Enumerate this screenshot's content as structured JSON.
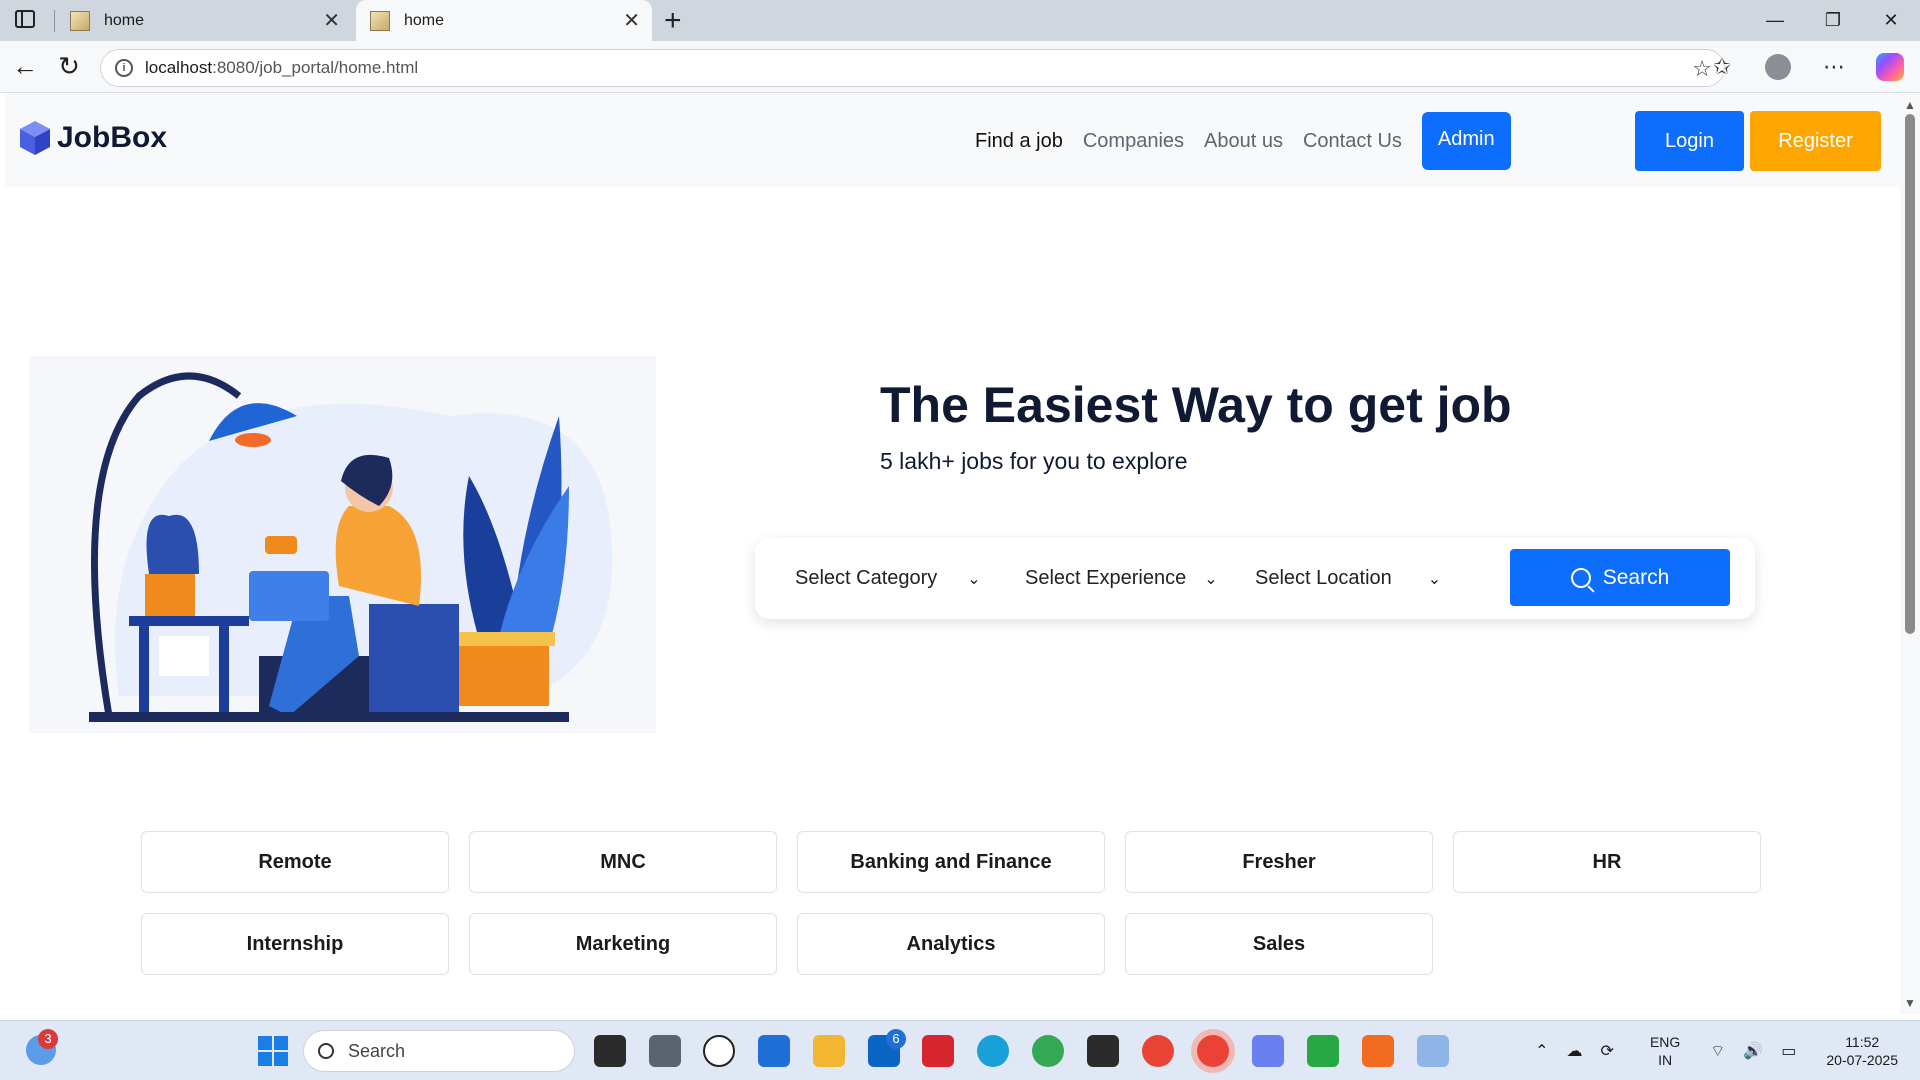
{
  "browser": {
    "tabs": [
      {
        "title": "home"
      },
      {
        "title": "home"
      }
    ],
    "url_host": "localhost",
    "url_path": ":8080/job_portal/home.html"
  },
  "site": {
    "brand": "JobBox",
    "nav": [
      "Find a job",
      "Companies",
      "About us",
      "Contact Us"
    ],
    "admin_label": "Admin",
    "login_label": "Login",
    "register_label": "Register"
  },
  "hero": {
    "title": "The Easiest Way to get job",
    "subtitle": "5 lakh+ jobs for you to explore"
  },
  "search": {
    "category": "Select Category",
    "experience": "Select Experience",
    "location": "Select Location",
    "button": "Search"
  },
  "categories": [
    "Remote",
    "MNC",
    "Banking and Finance",
    "Fresher",
    "HR",
    "Internship",
    "Marketing",
    "Analytics",
    "Sales"
  ],
  "taskbar": {
    "search_placeholder": "Search",
    "widgets_badge": "3",
    "linkedin_badge": "6",
    "lang_line1": "ENG",
    "lang_line2": "IN",
    "time": "11:52",
    "date": "20-07-2025"
  },
  "colors": {
    "primary": "#0d6efd",
    "register": "#ffa500",
    "heading": "#111a33"
  }
}
